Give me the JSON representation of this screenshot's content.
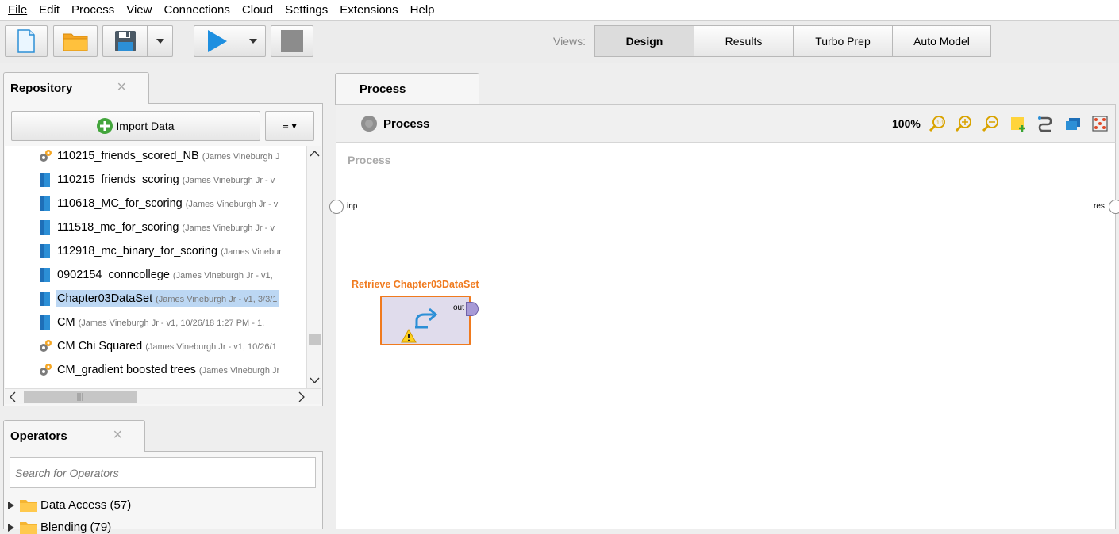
{
  "menu": [
    "File",
    "Edit",
    "Process",
    "View",
    "Connections",
    "Cloud",
    "Settings",
    "Extensions",
    "Help"
  ],
  "toolbar": {
    "views_label": "Views:",
    "views": [
      {
        "label": "Design",
        "active": true
      },
      {
        "label": "Results",
        "active": false
      },
      {
        "label": "Turbo Prep",
        "active": false
      },
      {
        "label": "Auto Model",
        "active": false
      }
    ]
  },
  "repository": {
    "tab_label": "Repository",
    "close": "×",
    "import_label": "Import Data",
    "menu_label": "≡ ▾",
    "items": [
      {
        "name": "110215_friends_scored_NB",
        "meta": "(James Vineburgh J",
        "icon": "process-gear-icon",
        "selected": false
      },
      {
        "name": "110215_friends_scoring",
        "meta": "(James Vineburgh Jr - v",
        "icon": "data-table-icon",
        "selected": false
      },
      {
        "name": "110618_MC_for_scoring",
        "meta": "(James Vineburgh Jr - v",
        "icon": "data-table-icon",
        "selected": false
      },
      {
        "name": "111518_mc_for_scoring",
        "meta": "(James Vineburgh Jr - v",
        "icon": "data-table-icon",
        "selected": false
      },
      {
        "name": "112918_mc_binary_for_scoring",
        "meta": "(James Vinebur",
        "icon": "data-table-icon",
        "selected": false
      },
      {
        "name": "0902154_conncollege",
        "meta": "(James Vineburgh Jr - v1,",
        "icon": "data-table-icon",
        "selected": false
      },
      {
        "name": "Chapter03DataSet",
        "meta": "(James Vineburgh Jr - v1, 3/3/1",
        "icon": "data-table-icon",
        "selected": true
      },
      {
        "name": "CM",
        "meta": "(James Vineburgh Jr - v1, 10/26/18 1:27 PM - 1.",
        "icon": "data-table-icon",
        "selected": false
      },
      {
        "name": "CM Chi Squared",
        "meta": "(James Vineburgh Jr - v1, 10/26/1",
        "icon": "process-gear-icon",
        "selected": false
      },
      {
        "name": "CM_gradient boosted trees",
        "meta": "(James Vineburgh Jr",
        "icon": "process-gear-icon",
        "selected": false
      }
    ]
  },
  "operators": {
    "tab_label": "Operators",
    "close": "×",
    "search_placeholder": "Search for Operators",
    "groups": [
      {
        "label": "Data Access (57)"
      },
      {
        "label": "Blending (79)"
      }
    ]
  },
  "process": {
    "tab_label": "Process",
    "header_title": "Process",
    "zoom": "100%",
    "canvas_label": "Process",
    "port_inp": "inp",
    "port_res": "res",
    "operator": {
      "title": "Retrieve Chapter03DataSet",
      "port_out": "out"
    }
  },
  "colors": {
    "accent_orange": "#f07a1e",
    "selection": "#bcd7f3",
    "play_blue": "#1e8fe0"
  }
}
